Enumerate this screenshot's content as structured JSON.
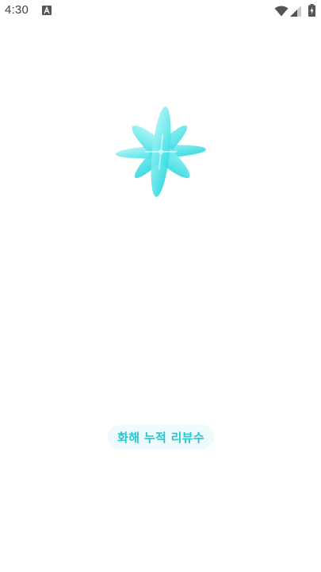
{
  "status_bar": {
    "time": "4:30",
    "icons": [
      "notification-a-icon",
      "wifi-icon",
      "signal-icon",
      "battery-charging-icon"
    ]
  },
  "splash": {
    "logo_icon": "flower-logo-icon",
    "caption": "화해 누적 리뷰수"
  },
  "colors": {
    "accent": "#26c6cf",
    "logo_light": "#a7f3f6",
    "logo_dark": "#21d6dc",
    "pill_bg": "#eefbfc",
    "background": "#ffffff"
  }
}
